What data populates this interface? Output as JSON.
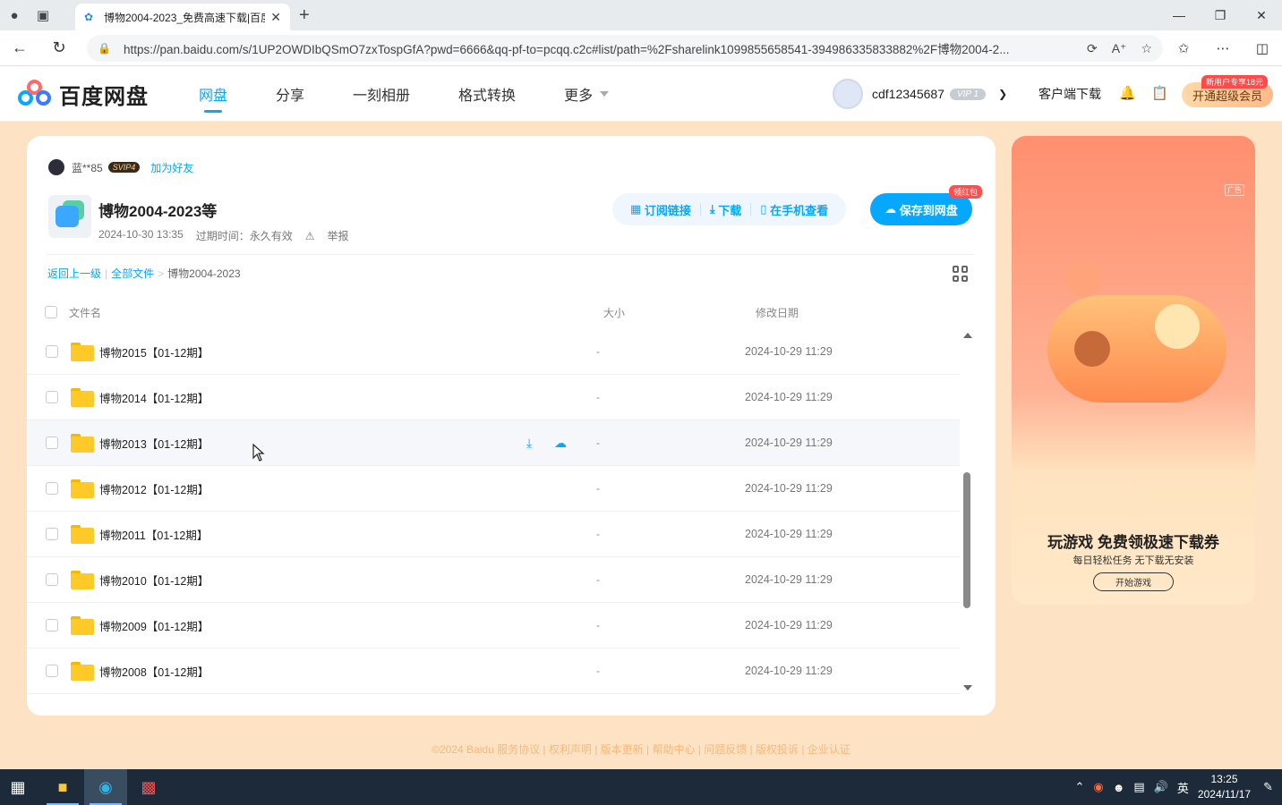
{
  "browser": {
    "tab_title": "博物2004-2023_免费高速下载|百度网盘",
    "url": "https://pan.baidu.com/s/1UP2OWDIbQSmO7zxTospGfA?pwd=6666&qq-pf-to=pcqq.c2c#list/path=%2Fsharelink1099855658541-394986335833882%2F博物2004-2..."
  },
  "header": {
    "logo_text": "百度网盘",
    "nav": [
      "网盘",
      "分享",
      "一刻相册",
      "格式转换",
      "更多"
    ],
    "username": "cdf12345687",
    "vip_label": "VIP 1",
    "client_download": "客户端下载",
    "super_vip_button": "开通超级会员",
    "new_user_tag": "新用户专享18元"
  },
  "share": {
    "sharer_name": "蓝**85",
    "sharer_level": "SVIP4",
    "add_friend": "加为好友",
    "title": "博物2004-2023等",
    "created": "2024-10-30 13:35",
    "expire": "过期时间：永久有效",
    "report": "举报",
    "actions": {
      "subscribe": "订阅链接",
      "download": "下载",
      "view_on_phone": "在手机查看",
      "save": "保存到网盘",
      "red_packet": "领红包"
    }
  },
  "breadcrumb": {
    "back": "返回上一级",
    "all_files": "全部文件",
    "current": "博物2004-2023"
  },
  "table": {
    "columns": {
      "name": "文件名",
      "size": "大小",
      "date": "修改日期"
    },
    "rows": [
      {
        "name": "博物2015【01-12期】",
        "size": "-",
        "date": "2024-10-29 11:29"
      },
      {
        "name": "博物2014【01-12期】",
        "size": "-",
        "date": "2024-10-29 11:29"
      },
      {
        "name": "博物2013【01-12期】",
        "size": "-",
        "date": "2024-10-29 11:29"
      },
      {
        "name": "博物2012【01-12期】",
        "size": "-",
        "date": "2024-10-29 11:29"
      },
      {
        "name": "博物2011【01-12期】",
        "size": "-",
        "date": "2024-10-29 11:29"
      },
      {
        "name": "博物2010【01-12期】",
        "size": "-",
        "date": "2024-10-29 11:29"
      },
      {
        "name": "博物2009【01-12期】",
        "size": "-",
        "date": "2024-10-29 11:29"
      },
      {
        "name": "博物2008【01-12期】",
        "size": "-",
        "date": "2024-10-29 11:29"
      }
    ]
  },
  "ad": {
    "tag": "广告",
    "title": "玩游戏 免费领极速下载券",
    "subtitle": "每日轻松任务 无下载无安装",
    "button": "开始游戏"
  },
  "footer": "©2024 Baidu  服务协议 | 权利声明 | 版本更新 | 帮助中心 | 问题反馈 | 版权投诉 | 企业认证",
  "taskbar": {
    "ime": "英",
    "time": "13:25",
    "date": "2024/11/17"
  },
  "colors": {
    "accent": "#06a7ff",
    "page_bg": "#fde3c4"
  }
}
